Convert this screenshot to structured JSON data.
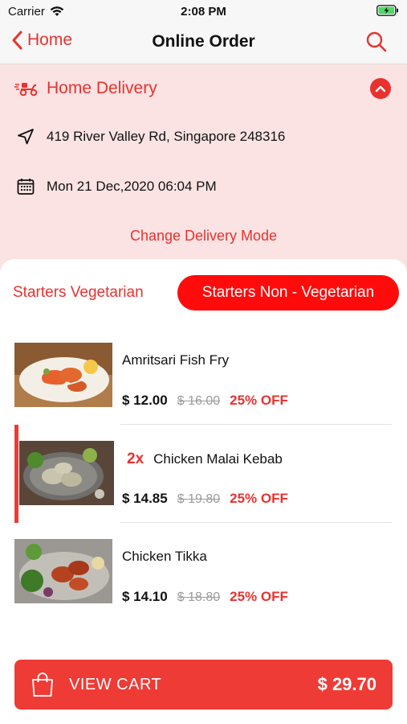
{
  "status_bar": {
    "carrier": "Carrier",
    "time": "2:08 PM"
  },
  "nav": {
    "back_label": "Home",
    "title": "Online Order",
    "search_icon": "search-icon"
  },
  "delivery": {
    "mode": "Home Delivery",
    "address": "419 River Valley Rd, Singapore 248316",
    "datetime": "Mon 21 Dec,2020 06:04 PM",
    "change_label": "Change Delivery Mode"
  },
  "tabs": [
    {
      "label": "Starters Vegetarian",
      "active": false
    },
    {
      "label": "Starters Non - Vegetarian",
      "active": true
    }
  ],
  "items": [
    {
      "name": "Amritsari Fish Fry",
      "quantity": "",
      "price": "$ 12.00",
      "old_price": "$ 16.00",
      "discount": "25% OFF",
      "selected": false
    },
    {
      "name": "Chicken Malai Kebab",
      "quantity": "2x",
      "price": "$ 14.85",
      "old_price": "$ 19.80",
      "discount": "25% OFF",
      "selected": true
    },
    {
      "name": "Chicken Tikka",
      "quantity": "",
      "price": "$ 14.10",
      "old_price": "$ 18.80",
      "discount": "25% OFF",
      "selected": false
    }
  ],
  "cart": {
    "label": "VIEW CART",
    "total": "$ 29.70"
  },
  "colors": {
    "accent": "#e8322f",
    "tab_active": "#ff0b0b",
    "delivery_bg": "#fbe3e3"
  }
}
